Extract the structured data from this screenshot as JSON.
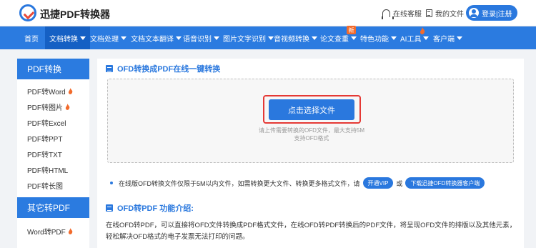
{
  "header": {
    "site_name": "迅捷PDF转换器",
    "support_label": "在线客服",
    "files_label": "我的文件",
    "login_label": "登录|注册"
  },
  "nav": {
    "items": [
      {
        "label": "首页",
        "dropdown": false,
        "active": false
      },
      {
        "label": "文档转换",
        "dropdown": true,
        "active": true
      },
      {
        "label": "文档处理",
        "dropdown": true,
        "active": false
      },
      {
        "label": "文档文本翻译",
        "dropdown": true,
        "active": false
      },
      {
        "label": "语音识别",
        "dropdown": true,
        "active": false
      },
      {
        "label": "图片文字识别",
        "dropdown": true,
        "active": false
      },
      {
        "label": "音视频转换",
        "dropdown": true,
        "active": false
      },
      {
        "label": "论文查重",
        "dropdown": true,
        "active": false
      },
      {
        "label": "特色功能",
        "dropdown": true,
        "active": false
      },
      {
        "label": "AI工具",
        "dropdown": true,
        "active": false
      },
      {
        "label": "客户端",
        "dropdown": true,
        "active": false
      }
    ],
    "new_badge": "新"
  },
  "sidebar": {
    "group1_title": "PDF转换",
    "group1_items": [
      {
        "label": "PDF转Word",
        "hot": true
      },
      {
        "label": "PDF转图片",
        "hot": true
      },
      {
        "label": "PDF转Excel",
        "hot": false
      },
      {
        "label": "PDF转PPT",
        "hot": false
      },
      {
        "label": "PDF转TXT",
        "hot": false
      },
      {
        "label": "PDF转HTML",
        "hot": false
      },
      {
        "label": "PDF转长图",
        "hot": false
      }
    ],
    "group2_title": "其它转PDF",
    "group2_items": [
      {
        "label": "Word转PDF",
        "hot": true
      }
    ]
  },
  "main": {
    "tool_title": "OFD转换成PDF在线一键转换",
    "select_button": "点击选择文件",
    "hint_line1": "请上传需要转换的OFD文件，最大支持5M",
    "hint_line2": "支持OFD格式",
    "notice_text": "在线版OFD转换文件仅限于5M以内文件，如需转换更大文件、转换更多格式文件，请",
    "vip_button": "开通VIP",
    "or_text": "或",
    "download_button": "下载迅捷OFD转换器客户端",
    "intro_title": "OFD转PDF 功能介绍:",
    "intro_text": "在线OFD转PDF，可以直接将OFD文件转换成PDF格式文件，在线OFD转PDF转换后的PDF文件，将呈现OFD文件的排版以及其他元素，轻松解决OFD格式的电子发票无法打印的问题。"
  },
  "colors": {
    "brand_blue": "#2b7be0",
    "active_nav": "#1560c4",
    "highlight_red": "#e53935",
    "hot_orange": "#f26b2c"
  }
}
